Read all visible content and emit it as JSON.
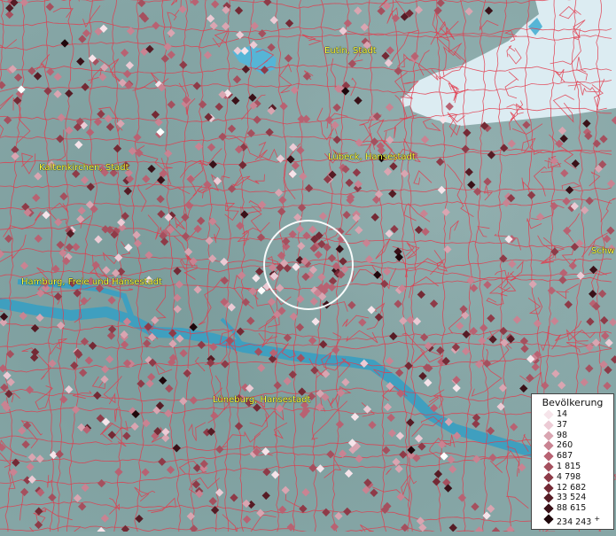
{
  "map": {
    "places": [
      {
        "id": "eutin",
        "label": "Eutin, Stadt"
      },
      {
        "id": "kaltenkirchen",
        "label": "Kaltenkirchen, Stadt"
      },
      {
        "id": "luebeck",
        "label": "Lübeck, Hansestadt"
      },
      {
        "id": "hamburg",
        "label": "Hamburg, Freie und Hansestadt"
      },
      {
        "id": "lueneburg",
        "label": "Lüneburg, Hansestadt"
      },
      {
        "id": "schwerin",
        "label": "Schw"
      }
    ],
    "legend": {
      "title": "Bevölkerung",
      "items": [
        {
          "value": "14",
          "color": "#f6e4ea"
        },
        {
          "value": "37",
          "color": "#eccbd5"
        },
        {
          "value": "98",
          "color": "#d9a5b1"
        },
        {
          "value": "260",
          "color": "#c98392"
        },
        {
          "value": "687",
          "color": "#b86272"
        },
        {
          "value": "1 815",
          "color": "#a5505e"
        },
        {
          "value": "4 798",
          "color": "#8e3b48"
        },
        {
          "value": "12 682",
          "color": "#742a35"
        },
        {
          "value": "33 524",
          "color": "#561c25"
        },
        {
          "value": "88 615",
          "color": "#3a1118"
        },
        {
          "value": "234 243",
          "color": "#1e070b",
          "suffix": "+"
        }
      ]
    },
    "colors": {
      "land": "#86a6a6",
      "sea": "#dcecf2",
      "river": "#3f9fbf",
      "borders": "#e23b4c",
      "label": "#ffff3a"
    }
  }
}
